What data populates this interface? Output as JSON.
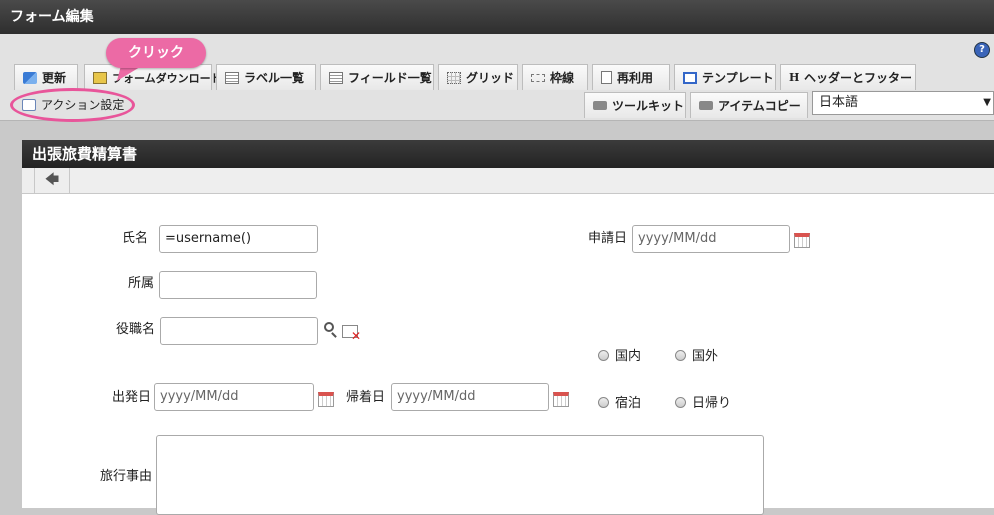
{
  "window": {
    "title": "フォーム編集"
  },
  "toolbar": {
    "tabs_row1": [
      {
        "label": "更新",
        "icon": "update-icon"
      },
      {
        "label": "フォームダウンロード",
        "icon": "download-icon"
      },
      {
        "label": "ラベル一覧",
        "icon": "list-icon"
      },
      {
        "label": "フィールド一覧",
        "icon": "list-icon"
      },
      {
        "label": "グリッド",
        "icon": "grid-icon"
      },
      {
        "label": "枠線",
        "icon": "frame-icon"
      },
      {
        "label": "再利用",
        "icon": "reuse-icon"
      },
      {
        "label": "テンプレート",
        "icon": "template-icon"
      },
      {
        "label": "ヘッダーとフッター",
        "icon": "header-icon"
      }
    ],
    "action_settings": "アクション設定",
    "toolkit": "ツールキット",
    "item_copy": "アイテムコピー",
    "language": "日本語",
    "help": "?"
  },
  "callout": {
    "text": "クリック"
  },
  "form": {
    "title": "出張旅費精算書",
    "back": "🡄",
    "fields": {
      "name_label": "氏名",
      "name_value": "=username()",
      "dept_label": "所属",
      "position_label": "役職名",
      "apply_date_label": "申請日",
      "apply_date_placeholder": "yyyy/MM/dd",
      "depart_date_label": "出発日",
      "depart_date_placeholder": "yyyy/MM/dd",
      "return_date_label": "帰着日",
      "return_date_placeholder": "yyyy/MM/dd",
      "reason_label": "旅行事由"
    },
    "radios": {
      "domestic": "国内",
      "overseas": "国外",
      "overnight": "宿泊",
      "day_trip": "日帰り"
    }
  }
}
